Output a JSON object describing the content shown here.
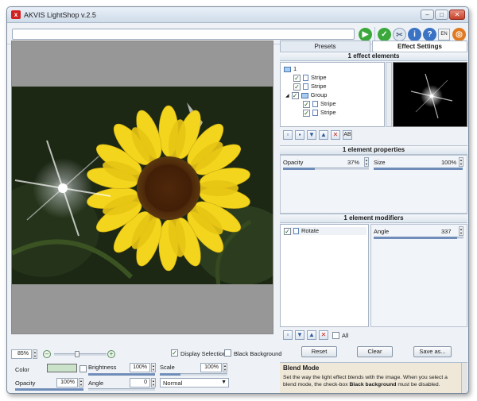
{
  "window": {
    "title": "AKVIS LightShop v.2.5",
    "app_icon_letter": "x",
    "controls": {
      "minimize": "–",
      "restore": "□",
      "close": "✕"
    }
  },
  "toolbar": {
    "path_value": "",
    "language": "EN",
    "icons": [
      "run-icon",
      "apply-icon",
      "preferences-icon",
      "about-icon",
      "help-icon",
      "akvis-logo-icon"
    ]
  },
  "canvas": {
    "zoom": "85%",
    "display_selection_label": "Display Selection",
    "display_selection_checked": true,
    "black_background_label": "Black Background",
    "black_background_checked": false
  },
  "color_controls": {
    "color_label": "Color",
    "color_value": "#c9e2c9",
    "brightness_label": "Brightness",
    "brightness_value": "100%",
    "scale_label": "Scale",
    "scale_value": "100%",
    "opacity_label": "Opacity",
    "opacity_value": "100%",
    "angle_label": "Angle",
    "angle_value": "0",
    "blend_mode_value": "Normal"
  },
  "tabs": [
    {
      "label": "Presets",
      "active": false
    },
    {
      "label": "Effect Settings",
      "active": true
    }
  ],
  "effect_elements": {
    "header": "1 effect elements",
    "tree": [
      {
        "label": "1",
        "type": "folder",
        "level": 0,
        "checked": null
      },
      {
        "label": "Stripe",
        "type": "file",
        "level": 1,
        "checked": true
      },
      {
        "label": "Stripe",
        "type": "file",
        "level": 1,
        "checked": true
      },
      {
        "label": "Group",
        "type": "folder",
        "level": 1,
        "checked": true
      },
      {
        "label": "Stripe",
        "type": "file",
        "level": 2,
        "checked": true
      },
      {
        "label": "Stripe",
        "type": "file",
        "level": 2,
        "checked": true
      }
    ],
    "buttons": [
      "new-icon",
      "new-group-icon",
      "move-down-icon",
      "move-up-icon",
      "delete-icon",
      "rename-icon"
    ]
  },
  "element_properties": {
    "header": "1 element properties",
    "opacity_label": "Opacity",
    "opacity_value": "37%",
    "size_label": "Size",
    "size_value": "100%"
  },
  "element_modifiers": {
    "header": "1 element modifiers",
    "items": [
      {
        "label": "Rotate",
        "checked": true
      }
    ],
    "angle_label": "Angle",
    "angle_value": "337",
    "all_label": "All",
    "all_checked": false
  },
  "actions": {
    "reset": "Reset",
    "clear": "Clear",
    "save_as": "Save as..."
  },
  "help": {
    "title": "Blend Mode",
    "text_part1": "Set the way the light effect blends with the image. When you select a blend mode, the check-box ",
    "text_bold": "Black background",
    "text_part2": " must be disabled."
  }
}
